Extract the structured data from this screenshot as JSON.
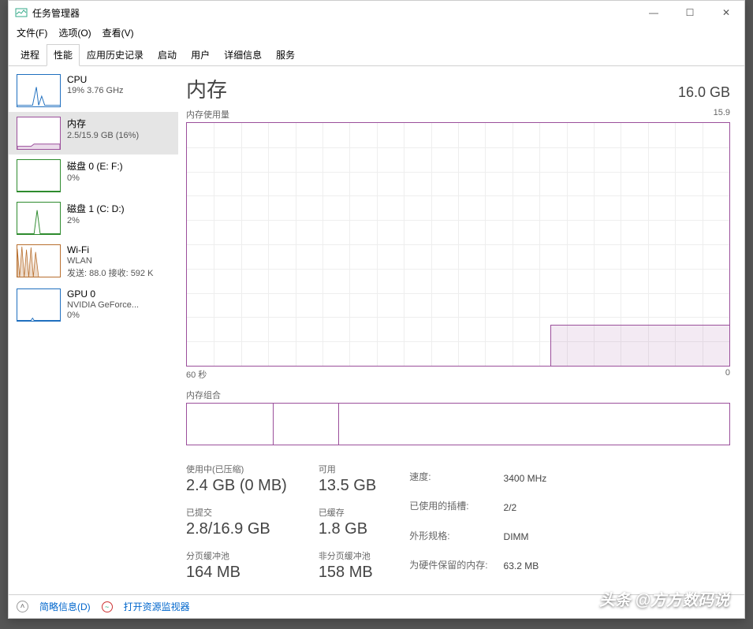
{
  "window": {
    "title": "任务管理器",
    "controls": {
      "min": "—",
      "max": "☐",
      "close": "✕"
    }
  },
  "menubar": [
    {
      "label": "文件(F)"
    },
    {
      "label": "选项(O)"
    },
    {
      "label": "查看(V)"
    }
  ],
  "tabs": [
    {
      "label": "进程",
      "active": false
    },
    {
      "label": "性能",
      "active": true
    },
    {
      "label": "应用历史记录",
      "active": false
    },
    {
      "label": "启动",
      "active": false
    },
    {
      "label": "用户",
      "active": false
    },
    {
      "label": "详细信息",
      "active": false
    },
    {
      "label": "服务",
      "active": false
    }
  ],
  "sidebar": [
    {
      "id": "cpu",
      "title": "CPU",
      "sub": "19% 3.76 GHz",
      "color": "#1f6fbf",
      "selected": false
    },
    {
      "id": "memory",
      "title": "内存",
      "sub": "2.5/15.9 GB (16%)",
      "color": "#9b4f9b",
      "selected": true
    },
    {
      "id": "disk0",
      "title": "磁盘 0 (E: F:)",
      "sub": "0%",
      "color": "#2e8b2e",
      "selected": false
    },
    {
      "id": "disk1",
      "title": "磁盘 1 (C: D:)",
      "sub": "2%",
      "color": "#2e8b2e",
      "selected": false
    },
    {
      "id": "wifi",
      "title": "Wi-Fi",
      "sub": "WLAN",
      "sub2": "发送: 88.0 接收: 592 K",
      "color": "#b86f2e",
      "selected": false
    },
    {
      "id": "gpu0",
      "title": "GPU 0",
      "sub": "NVIDIA GeForce...",
      "sub2": "0%",
      "color": "#1f6fbf",
      "selected": false
    }
  ],
  "main": {
    "title": "内存",
    "capacity": "16.0 GB",
    "usage_label": "内存使用量",
    "usage_max": "15.9",
    "x_start": "60 秒",
    "x_end": "0",
    "composition_label": "内存组合"
  },
  "chart_data": {
    "type": "area",
    "title": "内存使用量",
    "xlabel": "60 秒 → 0",
    "ylabel": "GB",
    "ylim": [
      0,
      15.9
    ],
    "x": [
      60,
      55,
      50,
      45,
      40,
      35,
      30,
      25,
      20,
      18,
      16,
      14,
      12,
      10,
      8,
      6,
      4,
      2,
      0
    ],
    "values": [
      0,
      0,
      0,
      0,
      0,
      0,
      0,
      0,
      0,
      0.1,
      2.3,
      2.5,
      2.6,
      2.55,
      2.5,
      2.55,
      2.5,
      2.5,
      2.5
    ],
    "composition_segments_pct": [
      16,
      12,
      72
    ]
  },
  "stats": {
    "col1": [
      {
        "label": "使用中(已压缩)",
        "value": "2.4 GB (0 MB)"
      },
      {
        "label": "已提交",
        "value": "2.8/16.9 GB"
      },
      {
        "label": "分页缓冲池",
        "value": "164 MB"
      }
    ],
    "col2": [
      {
        "label": "可用",
        "value": "13.5 GB"
      },
      {
        "label": "已缓存",
        "value": "1.8 GB"
      },
      {
        "label": "非分页缓冲池",
        "value": "158 MB"
      }
    ],
    "specs": [
      {
        "label": "速度:",
        "value": "3400 MHz"
      },
      {
        "label": "已使用的插槽:",
        "value": "2/2"
      },
      {
        "label": "外形规格:",
        "value": "DIMM"
      },
      {
        "label": "为硬件保留的内存:",
        "value": "63.2 MB"
      }
    ]
  },
  "footer": {
    "brief": "简略信息(D)",
    "resmon": "打开资源监视器"
  },
  "watermark": "头条 @方方数码说"
}
